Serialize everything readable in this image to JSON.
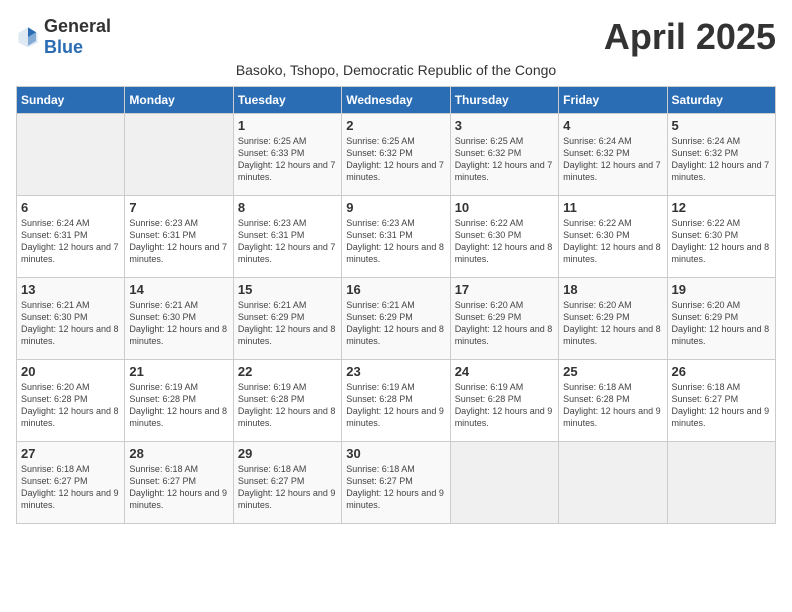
{
  "logo": {
    "general": "General",
    "blue": "Blue"
  },
  "title": "April 2025",
  "subtitle": "Basoko, Tshopo, Democratic Republic of the Congo",
  "days_of_week": [
    "Sunday",
    "Monday",
    "Tuesday",
    "Wednesday",
    "Thursday",
    "Friday",
    "Saturday"
  ],
  "weeks": [
    [
      {
        "day": "",
        "empty": true
      },
      {
        "day": "",
        "empty": true
      },
      {
        "day": "1",
        "sunrise": "6:25 AM",
        "sunset": "6:33 PM",
        "daylight": "12 hours and 7 minutes."
      },
      {
        "day": "2",
        "sunrise": "6:25 AM",
        "sunset": "6:32 PM",
        "daylight": "12 hours and 7 minutes."
      },
      {
        "day": "3",
        "sunrise": "6:25 AM",
        "sunset": "6:32 PM",
        "daylight": "12 hours and 7 minutes."
      },
      {
        "day": "4",
        "sunrise": "6:24 AM",
        "sunset": "6:32 PM",
        "daylight": "12 hours and 7 minutes."
      },
      {
        "day": "5",
        "sunrise": "6:24 AM",
        "sunset": "6:32 PM",
        "daylight": "12 hours and 7 minutes."
      }
    ],
    [
      {
        "day": "6",
        "sunrise": "6:24 AM",
        "sunset": "6:31 PM",
        "daylight": "12 hours and 7 minutes."
      },
      {
        "day": "7",
        "sunrise": "6:23 AM",
        "sunset": "6:31 PM",
        "daylight": "12 hours and 7 minutes."
      },
      {
        "day": "8",
        "sunrise": "6:23 AM",
        "sunset": "6:31 PM",
        "daylight": "12 hours and 7 minutes."
      },
      {
        "day": "9",
        "sunrise": "6:23 AM",
        "sunset": "6:31 PM",
        "daylight": "12 hours and 8 minutes."
      },
      {
        "day": "10",
        "sunrise": "6:22 AM",
        "sunset": "6:30 PM",
        "daylight": "12 hours and 8 minutes."
      },
      {
        "day": "11",
        "sunrise": "6:22 AM",
        "sunset": "6:30 PM",
        "daylight": "12 hours and 8 minutes."
      },
      {
        "day": "12",
        "sunrise": "6:22 AM",
        "sunset": "6:30 PM",
        "daylight": "12 hours and 8 minutes."
      }
    ],
    [
      {
        "day": "13",
        "sunrise": "6:21 AM",
        "sunset": "6:30 PM",
        "daylight": "12 hours and 8 minutes."
      },
      {
        "day": "14",
        "sunrise": "6:21 AM",
        "sunset": "6:30 PM",
        "daylight": "12 hours and 8 minutes."
      },
      {
        "day": "15",
        "sunrise": "6:21 AM",
        "sunset": "6:29 PM",
        "daylight": "12 hours and 8 minutes."
      },
      {
        "day": "16",
        "sunrise": "6:21 AM",
        "sunset": "6:29 PM",
        "daylight": "12 hours and 8 minutes."
      },
      {
        "day": "17",
        "sunrise": "6:20 AM",
        "sunset": "6:29 PM",
        "daylight": "12 hours and 8 minutes."
      },
      {
        "day": "18",
        "sunrise": "6:20 AM",
        "sunset": "6:29 PM",
        "daylight": "12 hours and 8 minutes."
      },
      {
        "day": "19",
        "sunrise": "6:20 AM",
        "sunset": "6:29 PM",
        "daylight": "12 hours and 8 minutes."
      }
    ],
    [
      {
        "day": "20",
        "sunrise": "6:20 AM",
        "sunset": "6:28 PM",
        "daylight": "12 hours and 8 minutes."
      },
      {
        "day": "21",
        "sunrise": "6:19 AM",
        "sunset": "6:28 PM",
        "daylight": "12 hours and 8 minutes."
      },
      {
        "day": "22",
        "sunrise": "6:19 AM",
        "sunset": "6:28 PM",
        "daylight": "12 hours and 8 minutes."
      },
      {
        "day": "23",
        "sunrise": "6:19 AM",
        "sunset": "6:28 PM",
        "daylight": "12 hours and 9 minutes."
      },
      {
        "day": "24",
        "sunrise": "6:19 AM",
        "sunset": "6:28 PM",
        "daylight": "12 hours and 9 minutes."
      },
      {
        "day": "25",
        "sunrise": "6:18 AM",
        "sunset": "6:28 PM",
        "daylight": "12 hours and 9 minutes."
      },
      {
        "day": "26",
        "sunrise": "6:18 AM",
        "sunset": "6:27 PM",
        "daylight": "12 hours and 9 minutes."
      }
    ],
    [
      {
        "day": "27",
        "sunrise": "6:18 AM",
        "sunset": "6:27 PM",
        "daylight": "12 hours and 9 minutes."
      },
      {
        "day": "28",
        "sunrise": "6:18 AM",
        "sunset": "6:27 PM",
        "daylight": "12 hours and 9 minutes."
      },
      {
        "day": "29",
        "sunrise": "6:18 AM",
        "sunset": "6:27 PM",
        "daylight": "12 hours and 9 minutes."
      },
      {
        "day": "30",
        "sunrise": "6:18 AM",
        "sunset": "6:27 PM",
        "daylight": "12 hours and 9 minutes."
      },
      {
        "day": "",
        "empty": true
      },
      {
        "day": "",
        "empty": true
      },
      {
        "day": "",
        "empty": true
      }
    ]
  ]
}
